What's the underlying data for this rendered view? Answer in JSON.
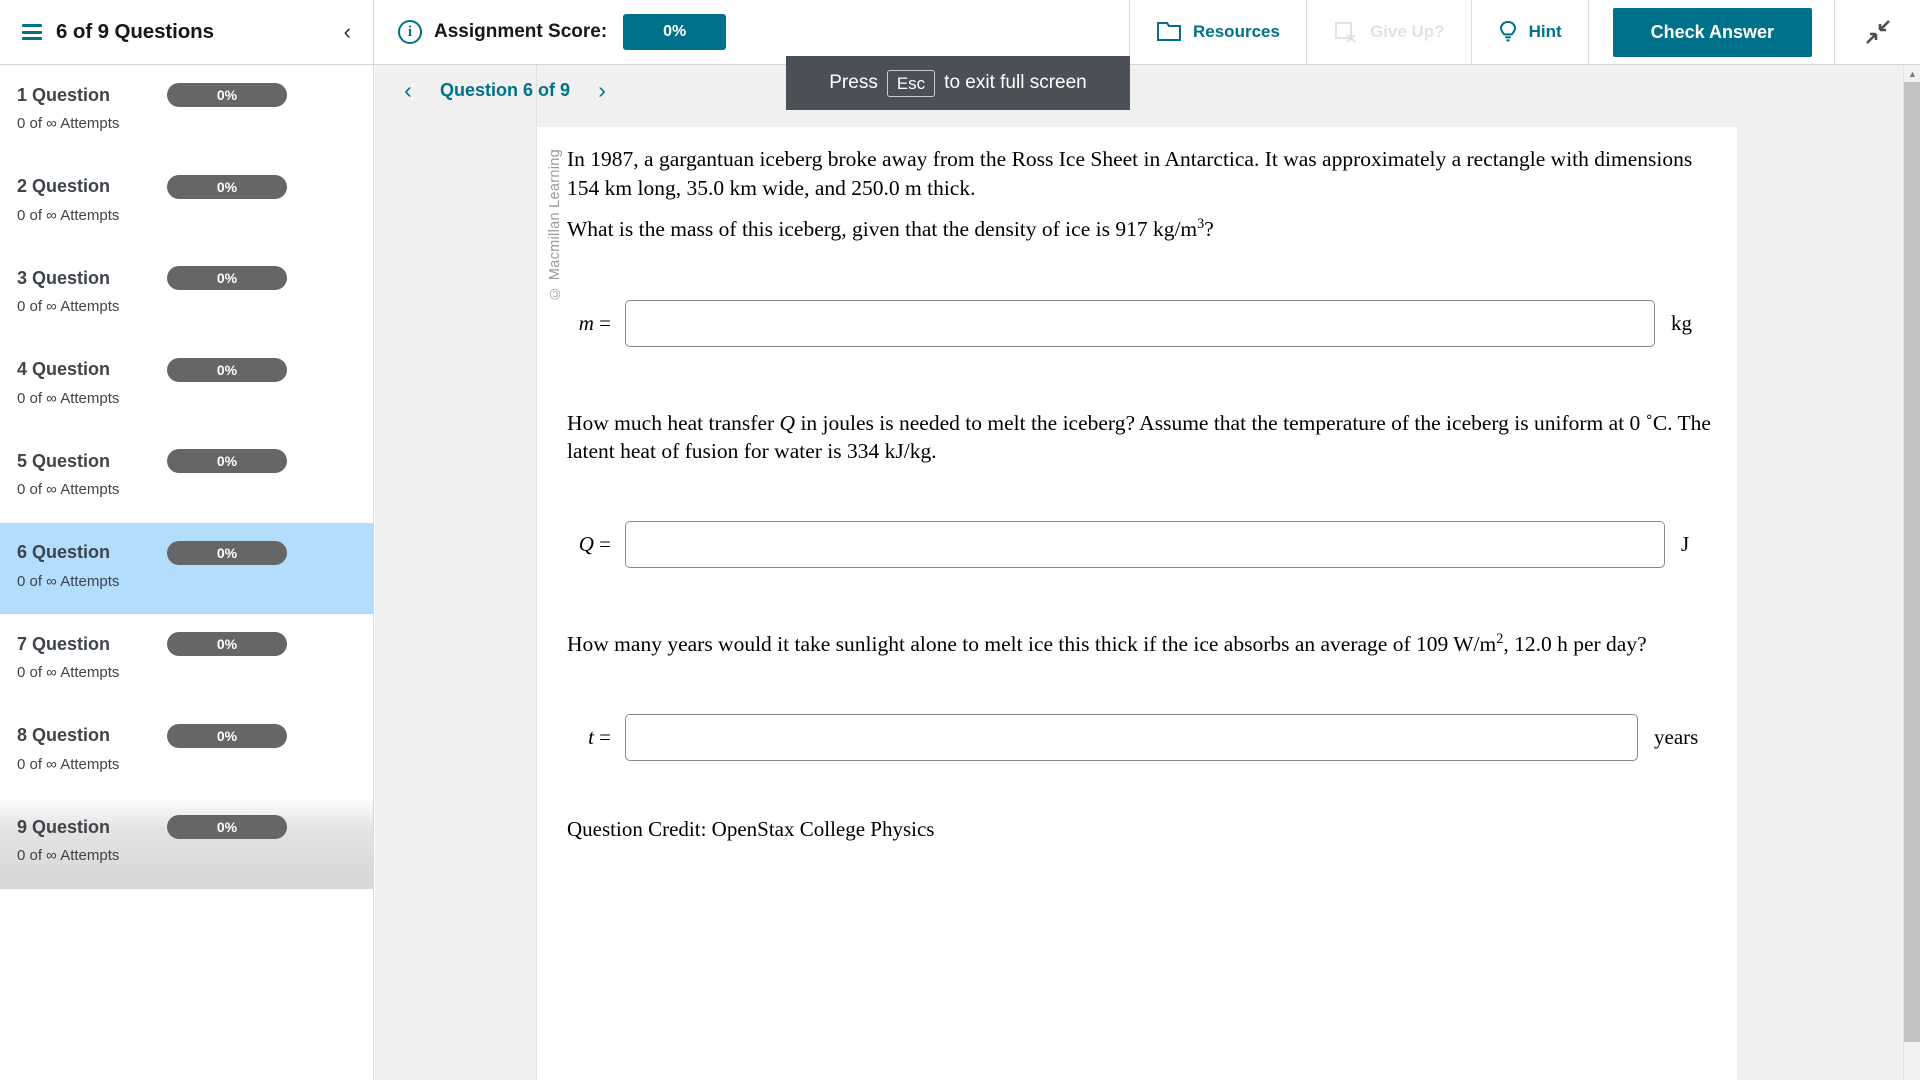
{
  "header": {
    "menu_icon": "hamburger-icon",
    "questions_title": "6 of 9 Questions",
    "collapse_icon": "chevron-left-icon",
    "info_icon": "info-circle-icon",
    "assignment_score_label": "Assignment Score:",
    "assignment_score_value": "0%",
    "actions": [
      {
        "label": "Resources",
        "icon": "folder-icon",
        "disabled": false
      },
      {
        "label": "Give Up?",
        "icon": "give-up-icon",
        "disabled": true
      },
      {
        "label": "Hint",
        "icon": "lightbulb-icon",
        "disabled": false
      }
    ],
    "check_answer_label": "Check Answer",
    "fullscreen_icon": "exit-fullscreen-icon",
    "accent_color": "#00718a"
  },
  "toast": {
    "press_text": "Press",
    "key_label": "Esc",
    "rest_text": "to exit full screen"
  },
  "sidebar": {
    "items": [
      {
        "name": "1 Question",
        "score": "0%",
        "attempts": "0 of ∞ Attempts",
        "active": false
      },
      {
        "name": "2 Question",
        "score": "0%",
        "attempts": "0 of ∞ Attempts",
        "active": false
      },
      {
        "name": "3 Question",
        "score": "0%",
        "attempts": "0 of ∞ Attempts",
        "active": false
      },
      {
        "name": "4 Question",
        "score": "0%",
        "attempts": "0 of ∞ Attempts",
        "active": false
      },
      {
        "name": "5 Question",
        "score": "0%",
        "attempts": "0 of ∞ Attempts",
        "active": false
      },
      {
        "name": "6 Question",
        "score": "0%",
        "attempts": "0 of ∞ Attempts",
        "active": true
      },
      {
        "name": "7 Question",
        "score": "0%",
        "attempts": "0 of ∞ Attempts",
        "active": false
      },
      {
        "name": "8 Question",
        "score": "0%",
        "attempts": "0 of ∞ Attempts",
        "active": false
      },
      {
        "name": "9 Question",
        "score": "0%",
        "attempts": "0 of ∞ Attempts",
        "active": false
      }
    ]
  },
  "question_nav": {
    "prev_icon": "chevron-left-icon",
    "next_icon": "chevron-right-icon",
    "label": "Question 6 of 9"
  },
  "question": {
    "copyright": "© Macmillan Learning",
    "paragraph_1": "In 1987, a gargantuan iceberg broke away from the Ross Ice Sheet in Antarctica. It was approximately a rectangle with dimensions 154 km long, 35.0 km wide, and 250.0 m thick.",
    "paragraph_2_pre": "What is the mass of this iceberg, given that the density of ice is 917 kg/m",
    "paragraph_2_sup": "3",
    "paragraph_2_post": "?",
    "answer_1": {
      "variable": "m",
      "equals": "=",
      "value": "",
      "placeholder": "",
      "unit": "kg"
    },
    "paragraph_3_a": "How much heat transfer ",
    "paragraph_3_var": "Q",
    "paragraph_3_b": " in joules is needed to melt the iceberg? Assume that the temperature of the iceberg is uniform at 0 ˚C. The latent heat of fusion for water is 334 kJ/kg.",
    "answer_2": {
      "variable": "Q",
      "equals": "=",
      "value": "",
      "placeholder": "",
      "unit": "J"
    },
    "paragraph_4_pre": "How many years would it take sunlight alone to melt ice this thick if the ice absorbs an average of 109 W/m",
    "paragraph_4_sup": "2",
    "paragraph_4_post": ", 12.0 h per day?",
    "answer_3": {
      "variable": "t",
      "equals": "=",
      "value": "",
      "placeholder": "",
      "unit": "years"
    },
    "credit": "Question Credit: OpenStax College Physics"
  },
  "scrollbar": {
    "up_icon": "caret-up-icon",
    "down_icon": "caret-down-icon"
  }
}
